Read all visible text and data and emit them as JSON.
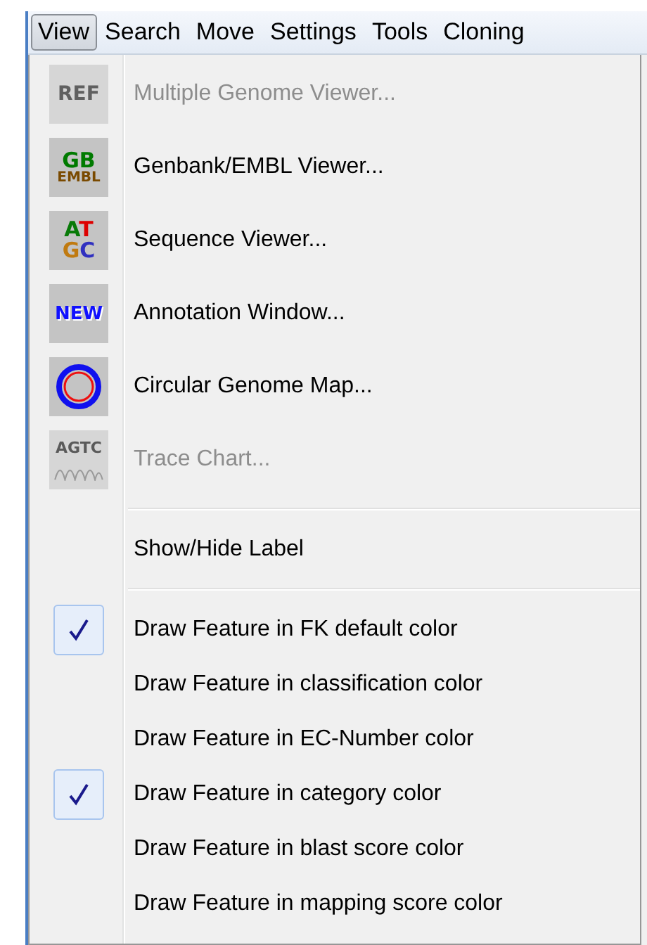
{
  "menu_bar": [
    {
      "label": "View",
      "selected": true
    },
    {
      "label": "Search",
      "selected": false
    },
    {
      "label": "Move",
      "selected": false
    },
    {
      "label": "Settings",
      "selected": false
    },
    {
      "label": "Tools",
      "selected": false
    },
    {
      "label": "Cloning",
      "selected": false
    }
  ],
  "menu": {
    "groups": [
      {
        "items": [
          {
            "label": "Multiple Genome Viewer...",
            "disabled": true,
            "icon": {
              "kind": "ref",
              "lines": [
                "REF"
              ]
            }
          },
          {
            "label": "Genbank/EMBL Viewer...",
            "disabled": false,
            "icon": {
              "kind": "gb",
              "lines": [
                "GB",
                "EMBL"
              ]
            }
          },
          {
            "label": "Sequence Viewer...",
            "disabled": false,
            "icon": {
              "kind": "atgc",
              "lines": [
                "AT",
                "GC"
              ]
            }
          },
          {
            "label": "Annotation Window...",
            "disabled": false,
            "icon": {
              "kind": "new",
              "lines": [
                "NEW"
              ]
            }
          },
          {
            "label": "Circular Genome Map...",
            "disabled": false,
            "icon": {
              "kind": "circle"
            }
          },
          {
            "label": "Trace Chart...",
            "disabled": true,
            "icon": {
              "kind": "trace",
              "lines": [
                "AGTC"
              ]
            }
          }
        ]
      },
      {
        "items": [
          {
            "label": "Show/Hide Label",
            "disabled": false
          }
        ]
      },
      {
        "items": [
          {
            "label": "Draw Feature in FK default color",
            "disabled": false,
            "checked": true
          },
          {
            "label": "Draw Feature in classification color",
            "disabled": false,
            "checked": false
          },
          {
            "label": "Draw Feature in EC-Number color",
            "disabled": false,
            "checked": false
          },
          {
            "label": "Draw Feature in category color",
            "disabled": false,
            "checked": true
          },
          {
            "label": "Draw Feature in blast score color",
            "disabled": false,
            "checked": false
          },
          {
            "label": "Draw Feature in mapping score color",
            "disabled": false,
            "checked": false
          }
        ]
      }
    ]
  }
}
